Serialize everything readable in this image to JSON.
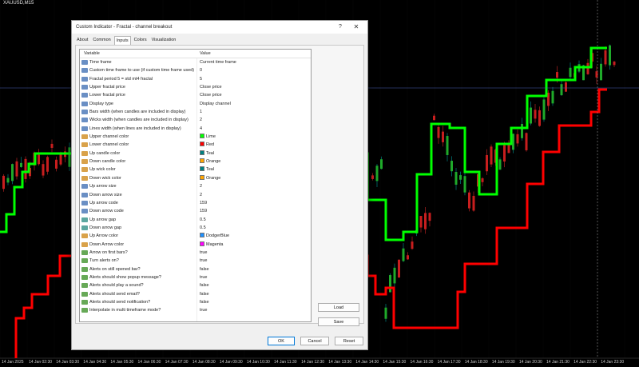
{
  "chart": {
    "symbol": "XAUUSD,M15",
    "background": "#000000",
    "upper_line_color": "#00ff00",
    "lower_line_color": "#ff0000",
    "up_candle_color": "#008080",
    "down_candle_color": "#ffa500",
    "time_labels": [
      "14 Jan 2025",
      "14 Jan 02:30",
      "14 Jan 03:30",
      "14 Jan 04:30",
      "14 Jan 05:30",
      "14 Jan 06:30",
      "14 Jan 07:30",
      "14 Jan 08:30",
      "14 Jan 09:30",
      "14 Jan 10:30",
      "14 Jan 11:30",
      "14 Jan 12:30",
      "14 Jan 13:30",
      "14 Jan 14:30",
      "14 Jan 15:30",
      "14 Jan 16:30",
      "14 Jan 17:30",
      "14 Jan 18:30",
      "14 Jan 19:30",
      "14 Jan 20:30",
      "14 Jan 21:30",
      "14 Jan 22:30",
      "14 Jan 23:30"
    ]
  },
  "dialog": {
    "title": "Custom Indicator - Fractal - channel breakout",
    "help_glyph": "?",
    "close_glyph": "✕",
    "tabs": [
      "About",
      "Common",
      "Inputs",
      "Colors",
      "Visualization"
    ],
    "active_tab": "Inputs",
    "columns": {
      "variable": "Variable",
      "value": "Value"
    },
    "rows": [
      {
        "icon": "int",
        "label": "Time frame",
        "value": "Current time frame"
      },
      {
        "icon": "int",
        "label": "Custom time frame to use (if custom time frame used)",
        "value": "0"
      },
      {
        "icon": "int",
        "label": "Fractal period 5 = std mt4 fractal",
        "value": "5"
      },
      {
        "icon": "int",
        "label": "Upper fractal price",
        "value": "Close price"
      },
      {
        "icon": "int",
        "label": "Lower fractal price",
        "value": "Close price"
      },
      {
        "icon": "int",
        "label": "Display type",
        "value": "Display channel"
      },
      {
        "icon": "int",
        "label": "Bars width (when candles are included in display)",
        "value": "1"
      },
      {
        "icon": "int",
        "label": "Wicks width (when candles are included in display)",
        "value": "2"
      },
      {
        "icon": "int",
        "label": "Lines width (when lines are included in display)",
        "value": "4"
      },
      {
        "icon": "col",
        "label": "Upper channel color",
        "value": "Lime",
        "swatch": "#00ff00"
      },
      {
        "icon": "col",
        "label": "Lower channel color",
        "value": "Red",
        "swatch": "#ff0000"
      },
      {
        "icon": "col",
        "label": "Up candle color",
        "value": "Teal",
        "swatch": "#008080"
      },
      {
        "icon": "col",
        "label": "Down candle color",
        "value": "Orange",
        "swatch": "#ffa500"
      },
      {
        "icon": "col",
        "label": "Up wick color",
        "value": "Teal",
        "swatch": "#008080"
      },
      {
        "icon": "col",
        "label": "Down wick color",
        "value": "Orange",
        "swatch": "#ffa500"
      },
      {
        "icon": "int",
        "label": "Up arrow size",
        "value": "2"
      },
      {
        "icon": "int",
        "label": "Down arrow size",
        "value": "2"
      },
      {
        "icon": "int",
        "label": "Up arrow code",
        "value": "159"
      },
      {
        "icon": "int",
        "label": "Down arrow code",
        "value": "159"
      },
      {
        "icon": "dbl",
        "label": "Up arrow gap",
        "value": "0.5"
      },
      {
        "icon": "dbl",
        "label": "Down arrow gap",
        "value": "0.5"
      },
      {
        "icon": "col",
        "label": "Up Arrow color",
        "value": "DodgerBlue",
        "swatch": "#1e90ff"
      },
      {
        "icon": "col",
        "label": "Down Arrow color",
        "value": "Magenta",
        "swatch": "#ff00ff"
      },
      {
        "icon": "bool",
        "label": "Arrow on first bars?",
        "value": "true"
      },
      {
        "icon": "bool",
        "label": "Turn alerts on?",
        "value": "true"
      },
      {
        "icon": "bool",
        "label": "Alerts on still opened bar?",
        "value": "false"
      },
      {
        "icon": "bool",
        "label": "Alerts should show popup message?",
        "value": "true"
      },
      {
        "icon": "bool",
        "label": "Alerts should play a sound?",
        "value": "false"
      },
      {
        "icon": "bool",
        "label": "Alerts should send email?",
        "value": "false"
      },
      {
        "icon": "bool",
        "label": "Alerts should send notification?",
        "value": "false"
      },
      {
        "icon": "bool",
        "label": "Interpolate in multi timeframe mode?",
        "value": "true"
      }
    ],
    "buttons": {
      "load": "Load",
      "save": "Save",
      "ok": "OK",
      "cancel": "Cancel",
      "reset": "Reset"
    }
  }
}
